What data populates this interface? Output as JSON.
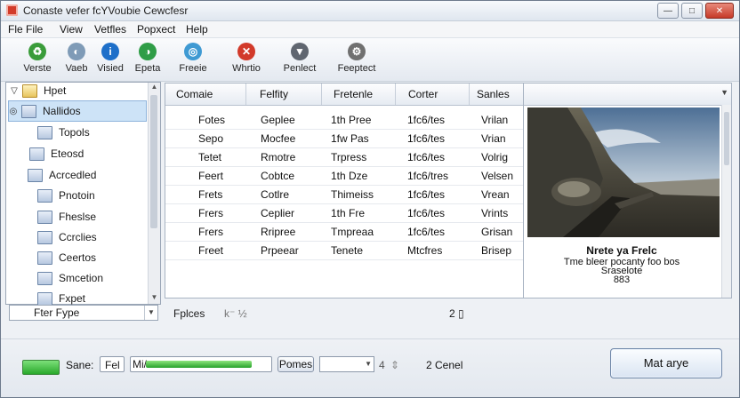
{
  "window": {
    "title": "Conaste vefer fcYVoubie Cewcfesr",
    "minimize_icon": "minimize-icon",
    "maximize_icon": "maximize-icon",
    "close_icon": "close-icon"
  },
  "menu": [
    "Fle File",
    "View",
    "Vetfles",
    "Popxect",
    "Help"
  ],
  "toolbar": [
    {
      "label": "Verste",
      "icon": "recycle-icon",
      "color": "#3a9c3a"
    },
    {
      "label": "Vaeb",
      "icon": "globe-icon",
      "color": "#7f9bb7"
    },
    {
      "label": "Visied",
      "icon": "info-icon",
      "color": "#1e6fc9"
    },
    {
      "label": "Epeta",
      "icon": "globe-green-icon",
      "color": "#2f9d47"
    },
    {
      "label": "Freeie",
      "icon": "world-icon",
      "color": "#3f9ad3"
    },
    {
      "label": "Whrtio",
      "icon": "stop-icon",
      "color": "#d23a2a"
    },
    {
      "label": "Penlect",
      "icon": "filter-icon",
      "color": "#606670"
    },
    {
      "label": "Feeptect",
      "icon": "settings-icon",
      "color": "#707070"
    }
  ],
  "sidebar": {
    "items": [
      {
        "label": "Hpet",
        "glyph": "▽",
        "icon": "folder-icon",
        "yellow": true
      },
      {
        "label": "Nallidos",
        "glyph": "◎",
        "icon": "document-icon",
        "yellow": false,
        "selected": true
      },
      {
        "label": "Topols",
        "glyph": "",
        "icon": "document-icon",
        "yellow": false
      },
      {
        "label": "Eteosd",
        "glyph": "",
        "icon": "document-icon",
        "yellow": false
      },
      {
        "label": "Acrcedled",
        "glyph": "",
        "icon": "folder-icon",
        "yellow": false
      },
      {
        "label": "Pnotoin",
        "glyph": "",
        "icon": "document-icon",
        "yellow": false
      },
      {
        "label": "Fheslse",
        "glyph": "",
        "icon": "document-icon",
        "yellow": false
      },
      {
        "label": "Ccrclies",
        "glyph": "",
        "icon": "folder-icon",
        "yellow": false
      },
      {
        "label": "Ceertos",
        "glyph": "",
        "icon": "document-icon",
        "yellow": false
      },
      {
        "label": "Smcetion",
        "glyph": "",
        "icon": "document-icon",
        "yellow": false
      },
      {
        "label": "Fxpet",
        "glyph": "",
        "icon": "document-icon",
        "yellow": false
      }
    ],
    "filter_value": "Fter Fype"
  },
  "grid": {
    "columns": [
      "Comaie",
      "Felfity",
      "Fretenle",
      "Corter",
      "Sanles"
    ],
    "rows": [
      [
        "Fotes",
        "Geplee",
        "1th Pree",
        "1fc6/tes",
        "Vrilan"
      ],
      [
        "Sepo",
        "Mocfee",
        "1fw Pas",
        "1fc6/tes",
        "Vrian"
      ],
      [
        "Tetet",
        "Rmotre",
        "Trpress",
        "1fc6/tes",
        "Volrig"
      ],
      [
        "Feert",
        "Cobtce",
        "1th Dze",
        "1fc6/tres",
        "Velsen"
      ],
      [
        "Frets",
        "Cotlre",
        "Thimeiss",
        "1fc6/tes",
        "Vrean"
      ],
      [
        "Frers",
        "Ceplier",
        "1th Fre",
        "1fc6/tes",
        "Vrints"
      ],
      [
        "Frers",
        "Rripree",
        "Tmpreaa",
        "1fc6/tes",
        "Grisan"
      ],
      [
        "Freet",
        "Prpeear",
        "Tenete",
        "Mtcfres",
        "Brisep"
      ]
    ]
  },
  "preview": {
    "caption_title": "Nrete ya Frelc",
    "caption_lines": [
      "Tme bleer pocanty foo bos",
      "Sraselote",
      "883"
    ]
  },
  "statusline": {
    "left": "Fplces",
    "middle": "k⁻ ½",
    "right": "2 ▯"
  },
  "bottom": {
    "sane_label": "Sane:",
    "feel_label": "Fel",
    "progress_label": "Mi/",
    "progress_percent": 83,
    "pomes_label": "Pomes",
    "count": "4",
    "cenet": "2 Cenel",
    "primary_label": "Mat arye",
    "down_icon": "chevron-down-icon"
  }
}
